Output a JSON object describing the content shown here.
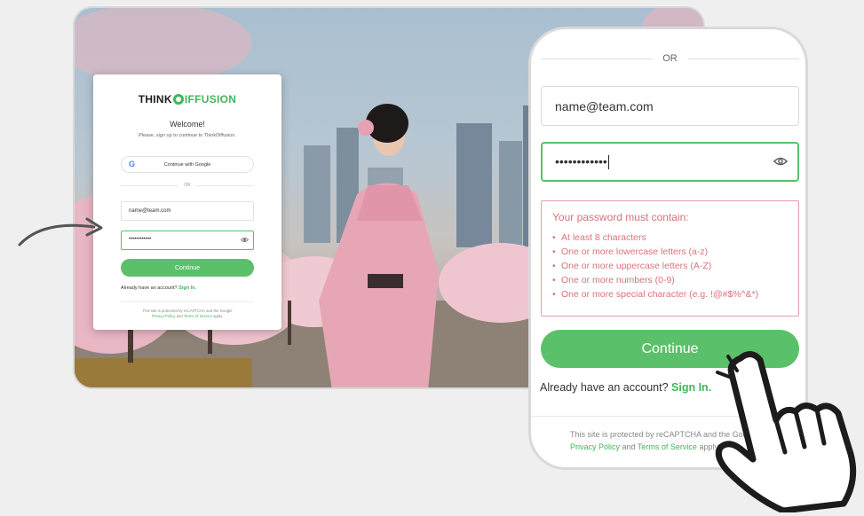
{
  "card": {
    "logo_left": "THINK",
    "logo_right": "IFFUSION",
    "welcome": "Welcome!",
    "subtitle": "Please, sign up to continue to ThinkDiffusion.",
    "google_label": "Continue with Google",
    "google_icon": "google-g-icon",
    "or_label": "OR",
    "email_value": "name@team.com",
    "password_value": "••••••••••••",
    "continue_label": "Continue",
    "signin_prompt": "Already have an account?",
    "signin_link": "Sign In.",
    "legal_line1": "This site is protected by reCAPTCHA and the Google",
    "legal_privacy": "Privacy Policy",
    "legal_and": "and",
    "legal_terms": "Terms of Service",
    "legal_apply": "apply."
  },
  "zoom": {
    "or_label": "OR",
    "email_value": "name@team.com",
    "password_value": "••••••••••••",
    "eye_icon": "eye-icon",
    "rules_title": "Your password must contain:",
    "rules": [
      "At least 8 characters",
      "One or more lowercase letters (a-z)",
      "One or more uppercase letters (A-Z)",
      "One or more numbers (0-9)",
      "One or more special character (e.g. !@#$%^&*)"
    ],
    "continue_label": "Continue",
    "signin_prompt": "Already have an account?",
    "signin_link": "Sign In.",
    "legal_line1": "This site is protected by reCAPTCHA and the Goo",
    "legal_privacy": "Privacy Policy",
    "legal_and": "and",
    "legal_terms": "Terms of Service",
    "legal_apply": "apply."
  },
  "colors": {
    "accent": "#5bc06a",
    "link": "#3eb85a",
    "error": "#d9727c",
    "background": "#efefef"
  },
  "decor": {
    "arrow_icon": "curved-arrow-icon",
    "hand_icon": "pointing-hand-cursor-icon"
  }
}
